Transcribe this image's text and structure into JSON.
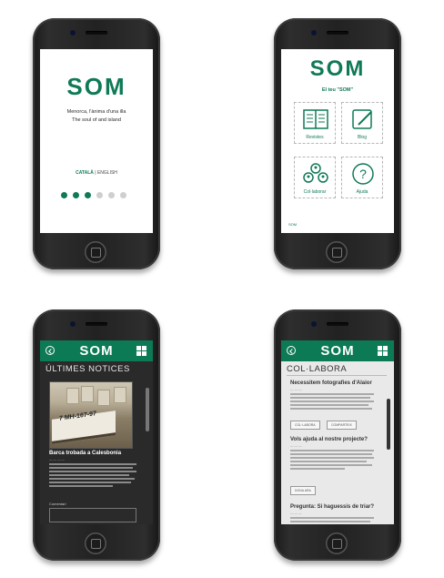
{
  "brand": {
    "name": "SOM",
    "color": "#0f7a55"
  },
  "splash": {
    "tagline_1": "Menorca, l'ànima d'una illa",
    "tagline_2": "The soul of and island",
    "lang_active": "CATALÀ",
    "lang_sep": " | ",
    "lang_other": "ENGLISH",
    "page_count": 6,
    "current_page": 3
  },
  "menu": {
    "subtitle": "El teu \"SOM\"",
    "tiles": [
      {
        "label": "Revistes",
        "icon": "book-icon"
      },
      {
        "label": "Blog",
        "icon": "pencil-icon"
      },
      {
        "label": "Col·laborar",
        "icon": "people-icon"
      },
      {
        "label": "Ajuda",
        "icon": "question-icon"
      }
    ],
    "footer": "SOM"
  },
  "news": {
    "section_title": "ÚLTIMES NOTICES",
    "photo_registration": "7 MH-167-97",
    "article_title": "Barca trobada a Calesbonia",
    "comments_label": "Comentari"
  },
  "collabora": {
    "section_title": "COL·LABORA",
    "q1_title": "Necessitem fotografies d'Alaior",
    "q1_btn_a": "COL·LABORA",
    "q1_btn_b": "COMPARTEIX",
    "q2_title": "Vols ajuda al nostre projecte?",
    "q2_btn": "DONA ARA",
    "q3_title": "Pregunta: Si haguessis de triar?"
  }
}
